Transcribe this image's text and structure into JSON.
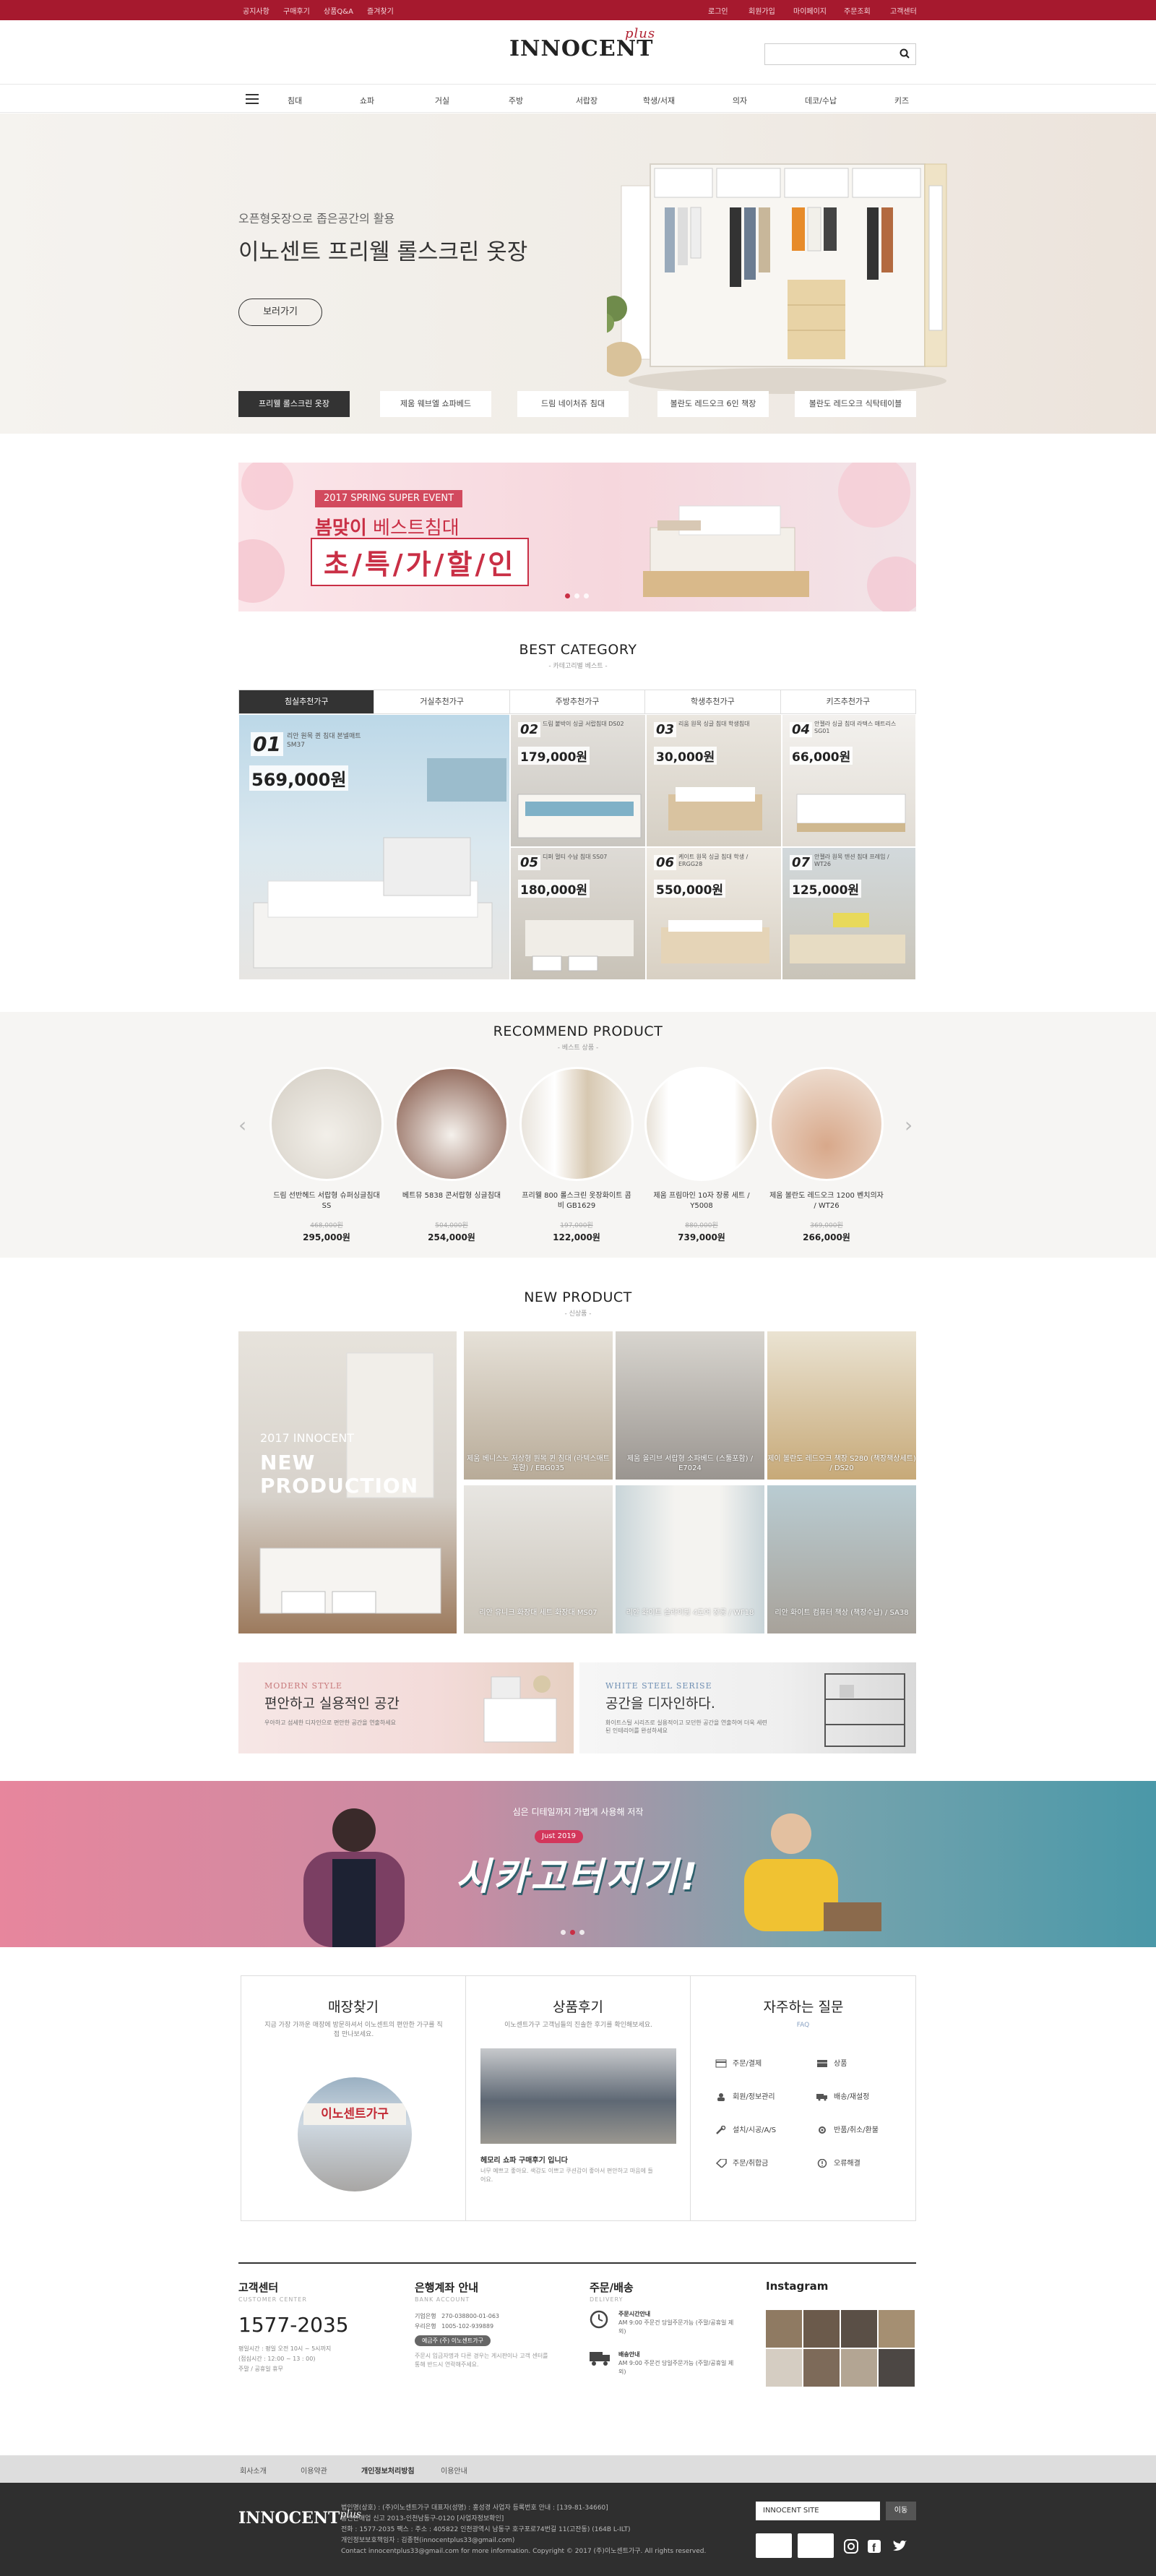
{
  "topbar": {
    "left": [
      "공지사항",
      "구매후기",
      "상품Q&A",
      "즐겨찾기"
    ],
    "right": [
      "로그인",
      "회원가입",
      "마이페이지",
      "주문조회",
      "고객센터"
    ]
  },
  "brand": {
    "name": "INNOCENT",
    "plus": "plus"
  },
  "nav": {
    "items": [
      "침대",
      "쇼파",
      "거실",
      "주방",
      "서랍장",
      "학생/서재",
      "의자",
      "데코/수납",
      "키즈"
    ]
  },
  "hero": {
    "subtitle": "오픈형옷장으로 좁은공간의 활용",
    "title": "이노센트 프리웰 롤스크린 옷장",
    "button": "보러가기",
    "tabs": [
      "프리웰 롤스크린 옷장",
      "제움 웨브엘 쇼파베드",
      "드림 네이처쥬 침대",
      "볼란도 레드오크 6인 책장",
      "볼란도 레드오크 식탁테이블"
    ]
  },
  "spring_banner": {
    "tag": "2017 SPRING SUPER EVENT",
    "line1_red": "봄맞이",
    "line1_rest": " 베스트침대",
    "line2": "초/특/가/할/인"
  },
  "best_category": {
    "title": "BEST CATEGORY",
    "subtitle": "- 카테고리별 베스트 -",
    "tabs": [
      "침실추천가구",
      "거실추천가구",
      "주방추천가구",
      "학생추천가구",
      "키즈추천가구"
    ],
    "items": [
      {
        "num": "01",
        "desc": "리안 원목 퀸 침대 본넬매트 SM37",
        "price": "569,000원"
      },
      {
        "num": "02",
        "desc": "드림 붙박이 싱글 서랍침대 DS02",
        "price": "179,000원"
      },
      {
        "num": "03",
        "desc": "리움 원목 싱글 침대 학생침대",
        "price": "30,000원"
      },
      {
        "num": "04",
        "desc": "안젤라 싱글 침대 라텍스 매트리스 SG01",
        "price": "66,000원"
      },
      {
        "num": "05",
        "desc": "디퍼 멀티 수납 침대 SS07",
        "price": "180,000원"
      },
      {
        "num": "06",
        "desc": "케이트 원목 싱글 침대 학생 / ERGG28",
        "price": "550,000원"
      },
      {
        "num": "07",
        "desc": "안젤라 원목 텐션 침대 프레임 / WT26",
        "price": "125,000원"
      }
    ]
  },
  "recommend": {
    "title": "RECOMMEND PRODUCT",
    "subtitle": "- 베스트 상품 -",
    "items": [
      {
        "name": "드림 선반헤드 서랍형 슈퍼싱글침대SS",
        "old": "468,000원",
        "price": "295,000원"
      },
      {
        "name": "베트뮤 5838 콘서랍형 싱글침대",
        "old": "504,000원",
        "price": "254,000원"
      },
      {
        "name": "프리웰 800 롤스크린 옷장화이트 콤비 GB1629",
        "old": "197,000원",
        "price": "122,000원"
      },
      {
        "name": "제움 프림마인 10자 장롱 세트 / Y5008",
        "old": "880,000원",
        "price": "739,000원"
      },
      {
        "name": "제움 볼란도 레드오크 1200 벤치의자 / WT26",
        "old": "369,000원",
        "price": "266,000원"
      }
    ]
  },
  "new_product": {
    "title": "NEW PRODUCT",
    "subtitle": "- 신상품 -",
    "hero_small": "2017 INNOCENT",
    "hero_big1": "NEW",
    "hero_big2": "PRODUCTION",
    "items": [
      "제움 베니스노 저상형 원목 퀸 침대 (라텍스매트포함) / EBG035",
      "제움 올리브 서랍형 소파베드 (스툴포함) / E7024",
      "제이 볼란도 레드오크 책장 S280 (책장책상세트) / DS20",
      "리안 유니크 화장대 세트 화장대 MS07",
      "리안 화이트 슬라이딩 4도어 장롱 / WF18",
      "리안 화이트 컴퓨터 책상 (책장수납) / SA38"
    ]
  },
  "promos": [
    {
      "tag": "MODERN STYLE",
      "title": "편안하고 실용적인 공간",
      "desc": "우아하고 섬세한 디자인으로 편안한 공간을 연출하세요"
    },
    {
      "tag": "WHITE STEEL SERISE",
      "title": "공간을 디자인하다.",
      "desc": "화이트스틸 시리즈로 실용적이고 모던한 공간을 연출하여 더욱 세련된 인테리어를 완성하세요"
    }
  ],
  "celeb_banner": {
    "top": "심은 디테일까지 가볍게 사용해 저작",
    "tag": "Just 2019",
    "main": "시카고터지기!"
  },
  "info": {
    "store": {
      "title": "매장찾기",
      "desc": "지금 가장 가까운 매장에 방문하셔서 이노센트의 편안한 가구를 직접 만나보세요.",
      "sign": "이노센트가구"
    },
    "review": {
      "title": "상품후기",
      "desc": "이노센트가구 고객님들의 진솔한 후기를 확인해보세요.",
      "headline": "헤모리 쇼파 구매후기 입니다",
      "body": "너무 예쁘고 좋아요. 색감도 이쁘고 쿠션감이 좋아서 편안하고 마음에 들어요."
    },
    "faq": {
      "title": "자주하는 질문",
      "sub": "FAQ",
      "items": [
        "주문/결제",
        "상품",
        "회원/정보관리",
        "배송/재설정",
        "설치/시공/A/S",
        "반품/취소/환불",
        "주문/취합금",
        "오류해결"
      ]
    }
  },
  "footer_info": {
    "cs": {
      "title": "고객센터",
      "sub": "CUSTOMER CENTER",
      "phone": "1577-2035",
      "hours1": "평일시간 : 평일 오전 10시 ~ 5시까지",
      "hours2": "(점심시간 : 12:00 ~ 13 : 00)",
      "hours3": "주말 / 공휴일 휴무"
    },
    "bank": {
      "title": "은행계좌 안내",
      "sub": "BANK ACCOUNT",
      "row1_label": "기업은행",
      "row1_value": "270-038800-01-063",
      "row2_label": "우리은행",
      "row2_value": "1005-102-939889",
      "holder": "예금주 (주) 이노센트가구",
      "note": "주문시 입금자명과 다른 경우는 게시판이나 고객 센터를 통해 반드시 연락해주세요."
    },
    "delivery": {
      "title": "주문/배송",
      "sub": "DELIVERY",
      "r1t": "주문시간안내",
      "r1d": "AM 9:00 주문건 당일주문가능 (주말/공휴일 제외)",
      "r2t": "배송안내",
      "r2d": "AM 9:00 주문건 당일주문가능 (주말/공휴일 제외)"
    },
    "instagram": {
      "title": "Instagram"
    }
  },
  "bottom_links": [
    "회사소개",
    "이용약관",
    "개인정보처리방침",
    "이용안내"
  ],
  "footer": {
    "lines": [
      "법인명(상호) : (주)이노센트가구 대표자(성명) : 홍성경 사업자 등록번호 안내 : [139-81-34660]",
      "통신판매업 신고 2013-인천남동구-0120 [사업자정보확인]",
      "전화 : 1577-2035 팩스 : 주소 : 405822 인천광역시 남동구 호구포로74번길 11(고잔동) (164B L-ILT)",
      "개인정보보호책임자 : 김종현(innocentplus33@gmail.com)",
      "Contact innocentplus33@gmail.com for more information.  Copyright © 2017 (주)이노센트가구. All rights reserved."
    ],
    "site": "INNOCENT SITE",
    "go": "이동"
  },
  "colors": {
    "brand_red": "#a6192e",
    "accent": "#c92f45",
    "dark": "#333333"
  }
}
